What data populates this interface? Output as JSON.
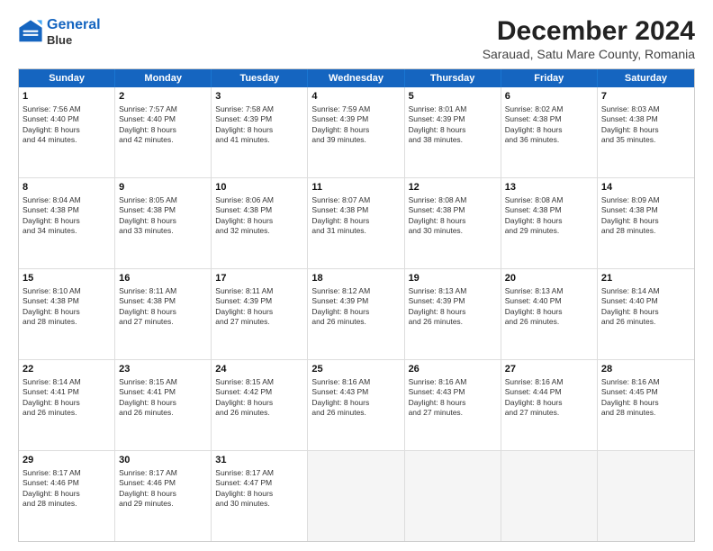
{
  "header": {
    "logo_line1": "General",
    "logo_line2": "Blue",
    "main_title": "December 2024",
    "subtitle": "Sarauad, Satu Mare County, Romania"
  },
  "weekdays": [
    "Sunday",
    "Monday",
    "Tuesday",
    "Wednesday",
    "Thursday",
    "Friday",
    "Saturday"
  ],
  "rows": [
    [
      {
        "num": "1",
        "lines": [
          "Sunrise: 7:56 AM",
          "Sunset: 4:40 PM",
          "Daylight: 8 hours",
          "and 44 minutes."
        ]
      },
      {
        "num": "2",
        "lines": [
          "Sunrise: 7:57 AM",
          "Sunset: 4:40 PM",
          "Daylight: 8 hours",
          "and 42 minutes."
        ]
      },
      {
        "num": "3",
        "lines": [
          "Sunrise: 7:58 AM",
          "Sunset: 4:39 PM",
          "Daylight: 8 hours",
          "and 41 minutes."
        ]
      },
      {
        "num": "4",
        "lines": [
          "Sunrise: 7:59 AM",
          "Sunset: 4:39 PM",
          "Daylight: 8 hours",
          "and 39 minutes."
        ]
      },
      {
        "num": "5",
        "lines": [
          "Sunrise: 8:01 AM",
          "Sunset: 4:39 PM",
          "Daylight: 8 hours",
          "and 38 minutes."
        ]
      },
      {
        "num": "6",
        "lines": [
          "Sunrise: 8:02 AM",
          "Sunset: 4:38 PM",
          "Daylight: 8 hours",
          "and 36 minutes."
        ]
      },
      {
        "num": "7",
        "lines": [
          "Sunrise: 8:03 AM",
          "Sunset: 4:38 PM",
          "Daylight: 8 hours",
          "and 35 minutes."
        ]
      }
    ],
    [
      {
        "num": "8",
        "lines": [
          "Sunrise: 8:04 AM",
          "Sunset: 4:38 PM",
          "Daylight: 8 hours",
          "and 34 minutes."
        ]
      },
      {
        "num": "9",
        "lines": [
          "Sunrise: 8:05 AM",
          "Sunset: 4:38 PM",
          "Daylight: 8 hours",
          "and 33 minutes."
        ]
      },
      {
        "num": "10",
        "lines": [
          "Sunrise: 8:06 AM",
          "Sunset: 4:38 PM",
          "Daylight: 8 hours",
          "and 32 minutes."
        ]
      },
      {
        "num": "11",
        "lines": [
          "Sunrise: 8:07 AM",
          "Sunset: 4:38 PM",
          "Daylight: 8 hours",
          "and 31 minutes."
        ]
      },
      {
        "num": "12",
        "lines": [
          "Sunrise: 8:08 AM",
          "Sunset: 4:38 PM",
          "Daylight: 8 hours",
          "and 30 minutes."
        ]
      },
      {
        "num": "13",
        "lines": [
          "Sunrise: 8:08 AM",
          "Sunset: 4:38 PM",
          "Daylight: 8 hours",
          "and 29 minutes."
        ]
      },
      {
        "num": "14",
        "lines": [
          "Sunrise: 8:09 AM",
          "Sunset: 4:38 PM",
          "Daylight: 8 hours",
          "and 28 minutes."
        ]
      }
    ],
    [
      {
        "num": "15",
        "lines": [
          "Sunrise: 8:10 AM",
          "Sunset: 4:38 PM",
          "Daylight: 8 hours",
          "and 28 minutes."
        ]
      },
      {
        "num": "16",
        "lines": [
          "Sunrise: 8:11 AM",
          "Sunset: 4:38 PM",
          "Daylight: 8 hours",
          "and 27 minutes."
        ]
      },
      {
        "num": "17",
        "lines": [
          "Sunrise: 8:11 AM",
          "Sunset: 4:39 PM",
          "Daylight: 8 hours",
          "and 27 minutes."
        ]
      },
      {
        "num": "18",
        "lines": [
          "Sunrise: 8:12 AM",
          "Sunset: 4:39 PM",
          "Daylight: 8 hours",
          "and 26 minutes."
        ]
      },
      {
        "num": "19",
        "lines": [
          "Sunrise: 8:13 AM",
          "Sunset: 4:39 PM",
          "Daylight: 8 hours",
          "and 26 minutes."
        ]
      },
      {
        "num": "20",
        "lines": [
          "Sunrise: 8:13 AM",
          "Sunset: 4:40 PM",
          "Daylight: 8 hours",
          "and 26 minutes."
        ]
      },
      {
        "num": "21",
        "lines": [
          "Sunrise: 8:14 AM",
          "Sunset: 4:40 PM",
          "Daylight: 8 hours",
          "and 26 minutes."
        ]
      }
    ],
    [
      {
        "num": "22",
        "lines": [
          "Sunrise: 8:14 AM",
          "Sunset: 4:41 PM",
          "Daylight: 8 hours",
          "and 26 minutes."
        ]
      },
      {
        "num": "23",
        "lines": [
          "Sunrise: 8:15 AM",
          "Sunset: 4:41 PM",
          "Daylight: 8 hours",
          "and 26 minutes."
        ]
      },
      {
        "num": "24",
        "lines": [
          "Sunrise: 8:15 AM",
          "Sunset: 4:42 PM",
          "Daylight: 8 hours",
          "and 26 minutes."
        ]
      },
      {
        "num": "25",
        "lines": [
          "Sunrise: 8:16 AM",
          "Sunset: 4:43 PM",
          "Daylight: 8 hours",
          "and 26 minutes."
        ]
      },
      {
        "num": "26",
        "lines": [
          "Sunrise: 8:16 AM",
          "Sunset: 4:43 PM",
          "Daylight: 8 hours",
          "and 27 minutes."
        ]
      },
      {
        "num": "27",
        "lines": [
          "Sunrise: 8:16 AM",
          "Sunset: 4:44 PM",
          "Daylight: 8 hours",
          "and 27 minutes."
        ]
      },
      {
        "num": "28",
        "lines": [
          "Sunrise: 8:16 AM",
          "Sunset: 4:45 PM",
          "Daylight: 8 hours",
          "and 28 minutes."
        ]
      }
    ],
    [
      {
        "num": "29",
        "lines": [
          "Sunrise: 8:17 AM",
          "Sunset: 4:46 PM",
          "Daylight: 8 hours",
          "and 28 minutes."
        ]
      },
      {
        "num": "30",
        "lines": [
          "Sunrise: 8:17 AM",
          "Sunset: 4:46 PM",
          "Daylight: 8 hours",
          "and 29 minutes."
        ]
      },
      {
        "num": "31",
        "lines": [
          "Sunrise: 8:17 AM",
          "Sunset: 4:47 PM",
          "Daylight: 8 hours",
          "and 30 minutes."
        ]
      },
      null,
      null,
      null,
      null
    ]
  ]
}
